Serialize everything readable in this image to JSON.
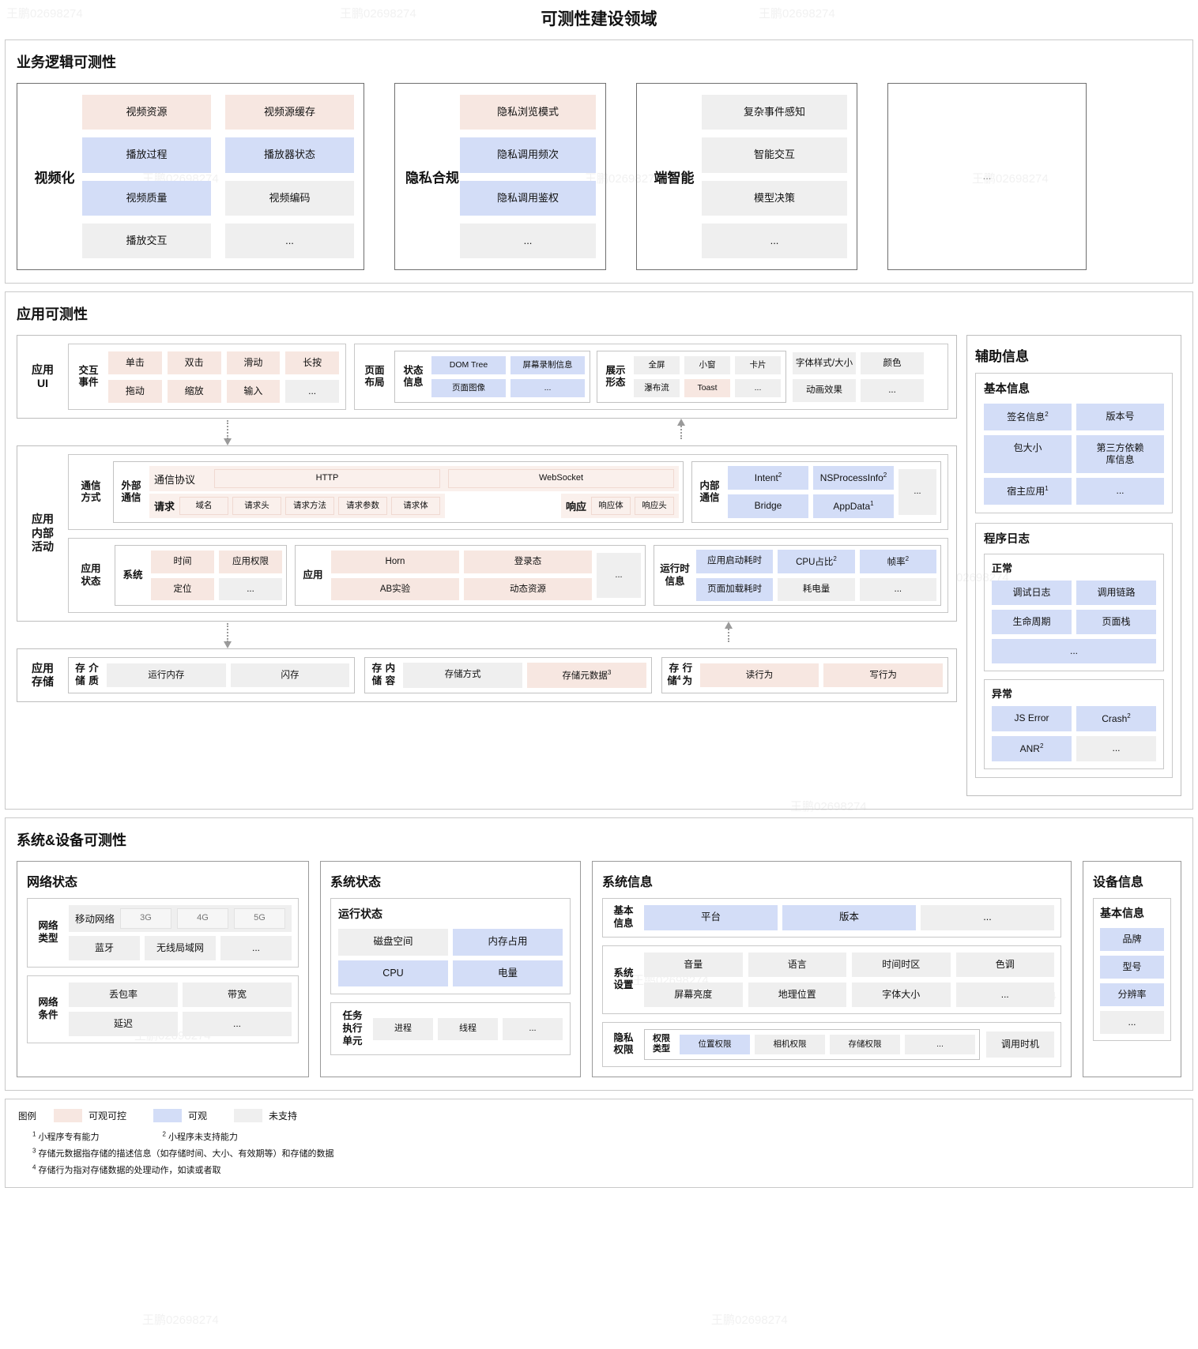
{
  "title": "可测性建设领域",
  "watermark": "王鹏02698274",
  "business": {
    "band_title": "业务逻辑可测性",
    "cards": [
      {
        "label": "视频化",
        "chips": [
          {
            "t": "视频资源",
            "c": "pink"
          },
          {
            "t": "视频源缓存",
            "c": "pink"
          },
          {
            "t": "播放过程",
            "c": "blue"
          },
          {
            "t": "播放器状态",
            "c": "blue"
          },
          {
            "t": "视频质量",
            "c": "blue"
          },
          {
            "t": "视频编码",
            "c": "gray"
          },
          {
            "t": "播放交互",
            "c": "gray"
          },
          {
            "t": "...",
            "c": "gray"
          }
        ],
        "cols": 2
      },
      {
        "label": "隐私\n合规",
        "chips": [
          {
            "t": "隐私浏览模式",
            "c": "pink"
          },
          {
            "t": "隐私调用频次",
            "c": "blue"
          },
          {
            "t": "隐私调用鉴权",
            "c": "blue"
          },
          {
            "t": "...",
            "c": "gray"
          }
        ],
        "cols": 1
      },
      {
        "label": "端智能",
        "chips": [
          {
            "t": "复杂事件感知",
            "c": "gray"
          },
          {
            "t": "智能交互",
            "c": "gray"
          },
          {
            "t": "模型决策",
            "c": "gray"
          },
          {
            "t": "...",
            "c": "gray"
          }
        ],
        "cols": 1
      },
      {
        "label": "",
        "chips": [
          {
            "t": "...",
            "c": "none"
          }
        ],
        "cols": 1
      }
    ]
  },
  "app": {
    "band_title": "应用可测性",
    "ui": {
      "label": "应用\nUI",
      "events": {
        "label": "交互\n事件",
        "chips": [
          {
            "t": "单击",
            "c": "pink"
          },
          {
            "t": "双击",
            "c": "pink"
          },
          {
            "t": "滑动",
            "c": "pink"
          },
          {
            "t": "长按",
            "c": "pink"
          },
          {
            "t": "拖动",
            "c": "pink"
          },
          {
            "t": "缩放",
            "c": "pink"
          },
          {
            "t": "输入",
            "c": "pink"
          },
          {
            "t": "...",
            "c": "gray"
          }
        ]
      },
      "layout": {
        "label": "页面\n布局",
        "state": {
          "label": "状态\n信息",
          "chips": [
            {
              "t": "DOM Tree",
              "c": "blue"
            },
            {
              "t": "屏幕录制信息",
              "c": "blue"
            },
            {
              "t": "页面图像",
              "c": "blue"
            },
            {
              "t": "...",
              "c": "blue"
            }
          ]
        },
        "form": {
          "label": "展示\n形态",
          "chips": [
            {
              "t": "全屏",
              "c": "gray"
            },
            {
              "t": "小窗",
              "c": "gray"
            },
            {
              "t": "卡片",
              "c": "gray"
            },
            {
              "t": "瀑布流",
              "c": "gray"
            },
            {
              "t": "Toast",
              "c": "pink"
            },
            {
              "t": "...",
              "c": "gray"
            }
          ]
        },
        "extra": [
          {
            "t": "字体样式/大小",
            "c": "gray"
          },
          {
            "t": "颜色",
            "c": "gray"
          },
          {
            "t": "动画效果",
            "c": "gray"
          },
          {
            "t": "...",
            "c": "gray"
          }
        ]
      }
    },
    "internal": {
      "label": "应用\n内部\n活动",
      "comm": {
        "label": "通信\n方式",
        "external": {
          "label": "外部\n通信",
          "protocol_label": "通信协议",
          "protocols": [
            {
              "t": "HTTP",
              "c": "pinko"
            },
            {
              "t": "WebSocket",
              "c": "pinko"
            }
          ],
          "request_label": "请求",
          "request": [
            {
              "t": "域名",
              "c": "pinko"
            },
            {
              "t": "请求头",
              "c": "pinko"
            },
            {
              "t": "请求方法",
              "c": "pinko"
            },
            {
              "t": "请求参数",
              "c": "pinko"
            },
            {
              "t": "请求体",
              "c": "pinko"
            }
          ],
          "response_label": "响应",
          "response": [
            {
              "t": "响应体",
              "c": "pinko"
            },
            {
              "t": "响应头",
              "c": "pinko"
            }
          ]
        },
        "internal": {
          "label": "内部\n通信",
          "chips": [
            {
              "t": "Intent",
              "c": "blue",
              "sup": "2"
            },
            {
              "t": "NSProcessInfo",
              "c": "blue",
              "sup": "2"
            },
            {
              "t": "Bridge",
              "c": "blue"
            },
            {
              "t": "AppData",
              "c": "blue",
              "sup": "1"
            }
          ],
          "more": {
            "t": "...",
            "c": "gray"
          }
        }
      },
      "state": {
        "label": "应用\n状态",
        "system": {
          "label": "系统",
          "chips": [
            {
              "t": "时间",
              "c": "pink"
            },
            {
              "t": "应用权限",
              "c": "pink"
            },
            {
              "t": "定位",
              "c": "pink"
            },
            {
              "t": "...",
              "c": "gray"
            }
          ]
        },
        "application": {
          "label": "应用",
          "chips": [
            {
              "t": "Horn",
              "c": "pink"
            },
            {
              "t": "登录态",
              "c": "pink"
            },
            {
              "t": "AB实验",
              "c": "pink"
            },
            {
              "t": "动态资源",
              "c": "pink"
            }
          ],
          "more": {
            "t": "...",
            "c": "gray"
          }
        },
        "runtime": {
          "label": "运行时\n信息",
          "chips": [
            {
              "t": "应用启动耗时",
              "c": "blue"
            },
            {
              "t": "CPU占比",
              "c": "blue",
              "sup": "2"
            },
            {
              "t": "帧率",
              "c": "blue",
              "sup": "2"
            },
            {
              "t": "页面加载耗时",
              "c": "blue"
            },
            {
              "t": "耗电量",
              "c": "gray"
            },
            {
              "t": "...",
              "c": "gray"
            }
          ]
        }
      }
    },
    "storage": {
      "label": "应用\n存储",
      "groups": [
        {
          "label": "存储\n介质",
          "sup": "",
          "chips": [
            {
              "t": "运行内存",
              "c": "gray"
            },
            {
              "t": "闪存",
              "c": "gray"
            }
          ]
        },
        {
          "label": "存储\n内容",
          "sup": "",
          "chips": [
            {
              "t": "存储方式",
              "c": "gray"
            },
            {
              "t": "存储元数据",
              "c": "pink",
              "sup": "3"
            }
          ]
        },
        {
          "label": "存储\n行为",
          "sup": "4",
          "chips": [
            {
              "t": "读行为",
              "c": "pink"
            },
            {
              "t": "写行为",
              "c": "pink"
            }
          ]
        }
      ]
    },
    "aux": {
      "title": "辅助信息",
      "basic": {
        "title": "基本信息",
        "chips": [
          {
            "t": "签名信息",
            "c": "blue",
            "sup": "2"
          },
          {
            "t": "版本号",
            "c": "blue"
          },
          {
            "t": "包大小",
            "c": "blue"
          },
          {
            "t": "第三方依赖\n库信息",
            "c": "blue"
          },
          {
            "t": "宿主应用",
            "c": "blue",
            "sup": "1"
          },
          {
            "t": "...",
            "c": "blue"
          }
        ]
      },
      "log": {
        "title": "程序日志",
        "normal": {
          "title": "正常",
          "chips": [
            {
              "t": "调试日志",
              "c": "blue"
            },
            {
              "t": "调用链路",
              "c": "blue"
            },
            {
              "t": "生命周期",
              "c": "blue"
            },
            {
              "t": "页面栈",
              "c": "blue"
            }
          ],
          "wide": {
            "t": "...",
            "c": "blue"
          }
        },
        "abnormal": {
          "title": "异常",
          "chips": [
            {
              "t": "JS Error",
              "c": "blue"
            },
            {
              "t": "Crash",
              "c": "blue",
              "sup": "2"
            },
            {
              "t": "ANR",
              "c": "blue",
              "sup": "2"
            },
            {
              "t": "...",
              "c": "gray"
            }
          ]
        }
      }
    }
  },
  "system": {
    "band_title": "系统&设备可测性",
    "network": {
      "title": "网络状态",
      "type": {
        "label": "网络\n类型",
        "mobile_label": "移动网络",
        "mobile": [
          {
            "t": "3G",
            "c": "gray2"
          },
          {
            "t": "4G",
            "c": "gray2"
          },
          {
            "t": "5G",
            "c": "gray2"
          }
        ],
        "row2": [
          {
            "t": "蓝牙",
            "c": "gray"
          },
          {
            "t": "无线局域网",
            "c": "gray"
          },
          {
            "t": "...",
            "c": "gray"
          }
        ]
      },
      "cond": {
        "label": "网络\n条件",
        "chips": [
          {
            "t": "丢包率",
            "c": "gray"
          },
          {
            "t": "带宽",
            "c": "gray"
          },
          {
            "t": "延迟",
            "c": "gray"
          },
          {
            "t": "...",
            "c": "gray"
          }
        ]
      }
    },
    "sysstate": {
      "title": "系统状态",
      "run": {
        "title": "运行状态",
        "chips": [
          {
            "t": "磁盘空间",
            "c": "gray"
          },
          {
            "t": "内存占用",
            "c": "blue"
          },
          {
            "t": "CPU",
            "c": "blue"
          },
          {
            "t": "电量",
            "c": "blue"
          }
        ]
      },
      "task": {
        "label": "任务\n执行\n单元",
        "chips": [
          {
            "t": "进程",
            "c": "gray"
          },
          {
            "t": "线程",
            "c": "gray"
          },
          {
            "t": "...",
            "c": "gray"
          }
        ]
      }
    },
    "sysinfo": {
      "title": "系统信息",
      "basic": {
        "label": "基本\n信息",
        "chips": [
          {
            "t": "平台",
            "c": "blue"
          },
          {
            "t": "版本",
            "c": "blue"
          },
          {
            "t": "...",
            "c": "gray"
          }
        ]
      },
      "settings": {
        "label": "系统\n设置",
        "chips": [
          {
            "t": "音量",
            "c": "gray"
          },
          {
            "t": "语言",
            "c": "gray"
          },
          {
            "t": "时间时区",
            "c": "gray"
          },
          {
            "t": "色调",
            "c": "gray"
          },
          {
            "t": "屏幕亮度",
            "c": "gray"
          },
          {
            "t": "地理位置",
            "c": "gray"
          },
          {
            "t": "字体大小",
            "c": "gray"
          },
          {
            "t": "...",
            "c": "gray"
          }
        ]
      },
      "privacy": {
        "label": "隐私\n权限",
        "type_label": "权限\n类型",
        "types": [
          {
            "t": "位置权限",
            "c": "blue"
          },
          {
            "t": "相机权限",
            "c": "gray"
          },
          {
            "t": "存储权限",
            "c": "gray"
          },
          {
            "t": "...",
            "c": "gray"
          }
        ],
        "timing": {
          "t": "调用时机",
          "c": "gray"
        }
      }
    },
    "device": {
      "title": "设备信息",
      "basic": {
        "title": "基本信息",
        "chips": [
          {
            "t": "品牌",
            "c": "blue"
          },
          {
            "t": "型号",
            "c": "blue"
          },
          {
            "t": "分辨率",
            "c": "blue"
          },
          {
            "t": "...",
            "c": "gray"
          }
        ]
      }
    }
  },
  "legend": {
    "title": "图例",
    "items": [
      {
        "label": "可观可控",
        "color": "#f7e7e1"
      },
      {
        "label": "可观",
        "color": "#d3ddf7"
      },
      {
        "label": "未支持",
        "color": "#efefef"
      }
    ],
    "notes": [
      {
        "n": "1",
        "text": "小程序专有能力"
      },
      {
        "n": "2",
        "text": "小程序未支持能力"
      },
      {
        "n": "3",
        "text": "存储元数据指存储的描述信息（如存储时间、大小、有效期等）和存储的数据"
      },
      {
        "n": "4",
        "text": "存储行为指对存储数据的处理动作，如读或者取"
      }
    ]
  }
}
